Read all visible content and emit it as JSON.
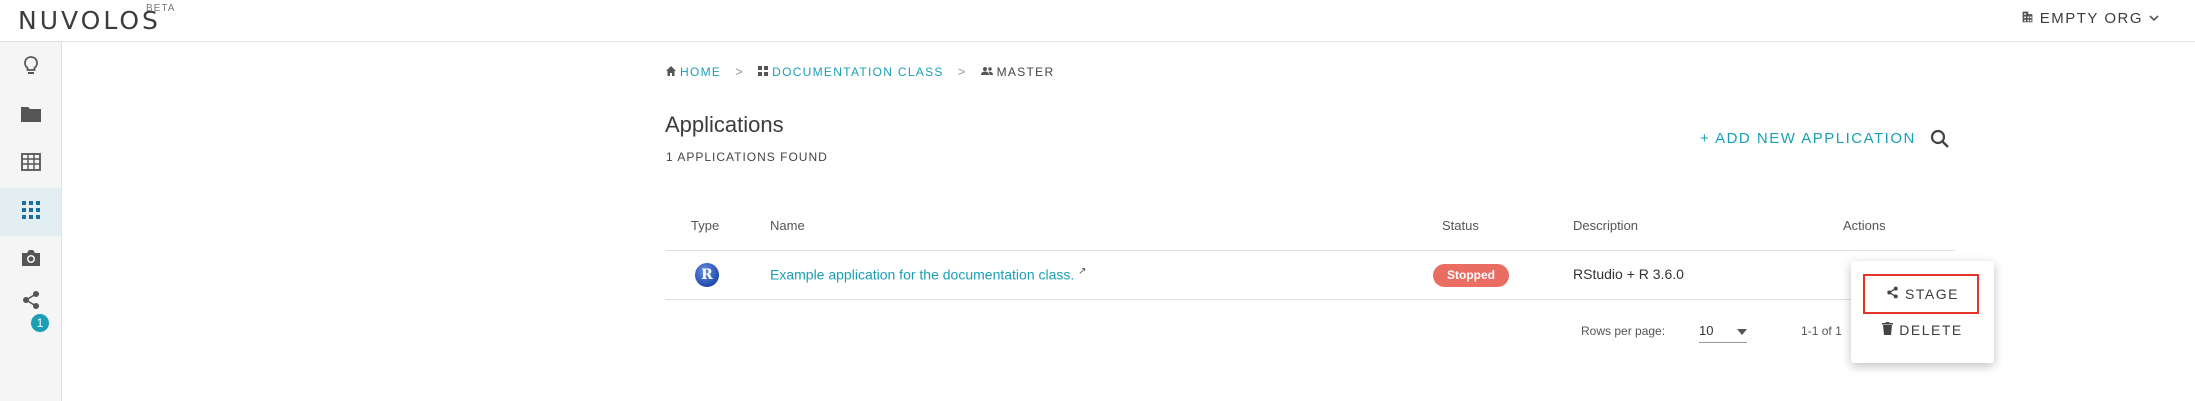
{
  "brand": {
    "name": "NUVOLOS",
    "sup": "BETA"
  },
  "org": {
    "label": "EMPTY ORG"
  },
  "sidebar": {
    "badge": "1"
  },
  "breadcrumb": {
    "home": "HOME",
    "space": "DOCUMENTATION CLASS",
    "instance": "MASTER"
  },
  "page": {
    "title": "Applications",
    "count": "1 APPLICATIONS FOUND",
    "add_label": "+ ADD NEW APPLICATION"
  },
  "table": {
    "headers": {
      "type": "Type",
      "name": "Name",
      "status": "Status",
      "description": "Description",
      "actions": "Actions"
    },
    "rows": [
      {
        "type_icon": "R",
        "name": "Example application for the documentation class.",
        "status": "Stopped",
        "description": "RStudio + R 3.6.0"
      }
    ]
  },
  "pager": {
    "rows_per_page_label": "Rows per page:",
    "rows_per_page": "10",
    "range": "1-1 of 1"
  },
  "menu": {
    "stage": "STAGE",
    "delete": "DELETE"
  },
  "colors": {
    "accent": "#1a9fb5",
    "status_stopped": "#e96d62",
    "highlight": "#e5352a"
  }
}
